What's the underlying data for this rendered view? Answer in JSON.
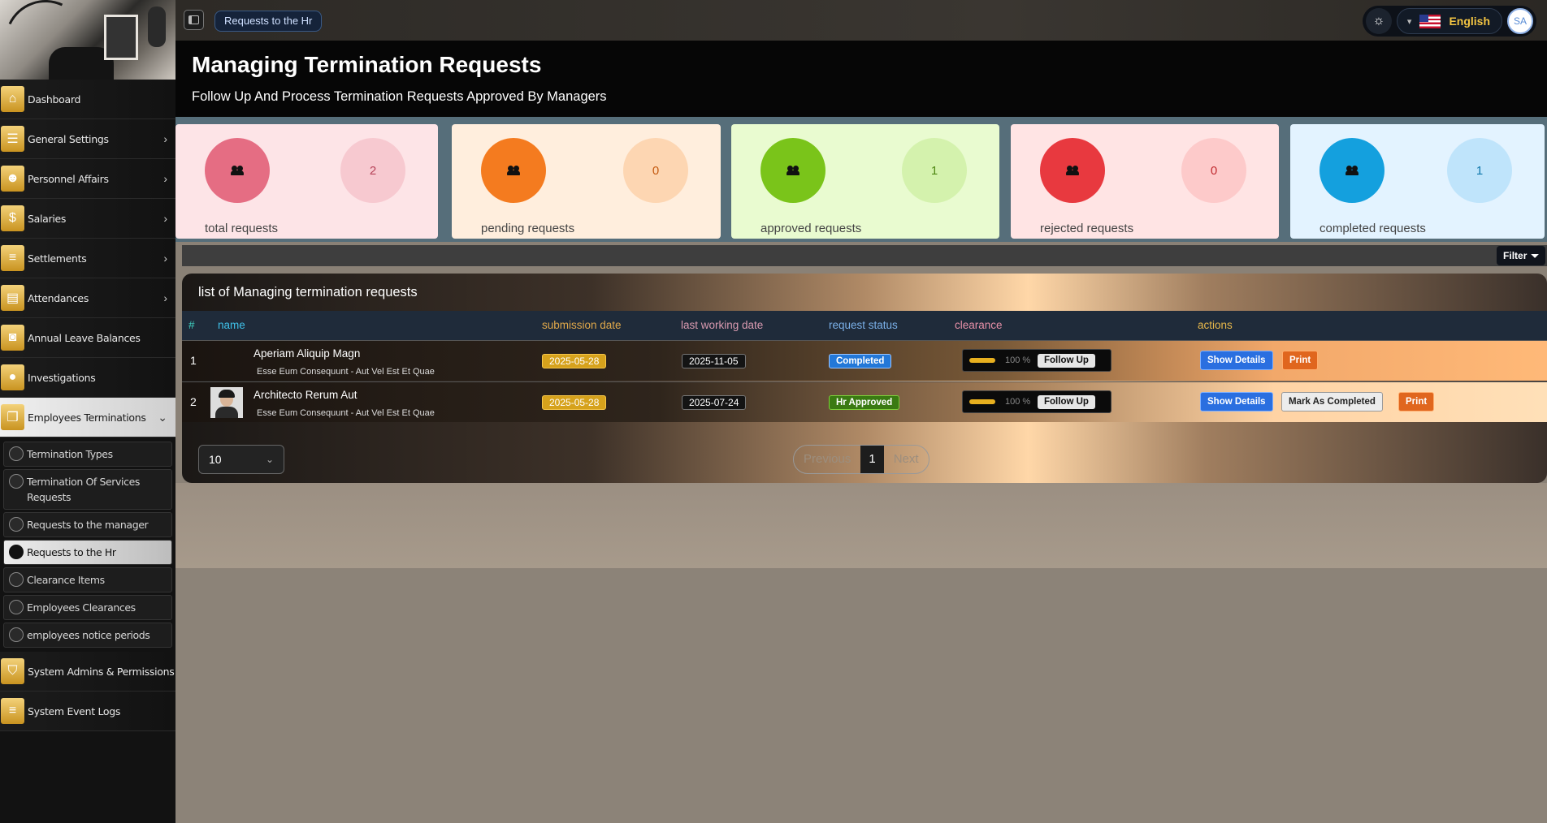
{
  "sidebar": {
    "items": [
      {
        "label": "Dashboard",
        "icon": "home-icon",
        "glyph": "⌂",
        "has_chevron": false
      },
      {
        "label": "General Settings",
        "icon": "sliders-icon",
        "glyph": "☰",
        "has_chevron": true
      },
      {
        "label": "Personnel Affairs",
        "icon": "users-icon",
        "glyph": "☻",
        "has_chevron": true
      },
      {
        "label": "Salaries",
        "icon": "money-icon",
        "glyph": "$",
        "has_chevron": true
      },
      {
        "label": "Settlements",
        "icon": "list-icon",
        "glyph": "≡",
        "has_chevron": true
      },
      {
        "label": "Attendances",
        "icon": "briefcase-icon",
        "glyph": "▤",
        "has_chevron": true
      },
      {
        "label": "Annual Leave Balances",
        "icon": "bag-icon",
        "glyph": "◙",
        "has_chevron": false
      },
      {
        "label": "Investigations",
        "icon": "circle-icon",
        "glyph": "●",
        "has_chevron": false
      },
      {
        "label": "Employees Terminations",
        "icon": "copy-icon",
        "glyph": "❐",
        "has_chevron": true
      }
    ],
    "sub_items": [
      {
        "label": "Termination Types"
      },
      {
        "label": "Termination Of Services Requests"
      },
      {
        "label": "Requests to the manager"
      },
      {
        "label": "Requests to the Hr"
      },
      {
        "label": "Clearance Items"
      },
      {
        "label": "Employees Clearances"
      },
      {
        "label": "employees notice periods"
      }
    ],
    "bottom_items": [
      {
        "label": "System Admins & Permissions",
        "icon": "shield-icon",
        "glyph": "⛉"
      },
      {
        "label": "System Event Logs",
        "icon": "list-icon",
        "glyph": "≡"
      }
    ]
  },
  "topbar": {
    "breadcrumb": "Requests to the Hr",
    "language": "English",
    "avatar_initials": "SA"
  },
  "header": {
    "title": "Managing Termination Requests",
    "subtitle": "Follow Up And Process Termination Requests Approved By Managers"
  },
  "stats": [
    {
      "label": "total requests",
      "value": "2",
      "bg": "#fde4e7",
      "circle": "#e56d83",
      "num_bg": "#f7c9d0",
      "num_color": "#b64258"
    },
    {
      "label": "pending requests",
      "value": "0",
      "bg": "#ffeedd",
      "circle": "#f47b1f",
      "num_bg": "#fdd6b2",
      "num_color": "#c45a10"
    },
    {
      "label": "approved requests",
      "value": "1",
      "bg": "#e9fbd0",
      "circle": "#7ac41a",
      "num_bg": "#d4f2ad",
      "num_color": "#4d8712"
    },
    {
      "label": "rejected requests",
      "value": "0",
      "bg": "#ffe4e4",
      "circle": "#e8393f",
      "num_bg": "#fdcaca",
      "num_color": "#c02a2f"
    },
    {
      "label": "completed requests",
      "value": "1",
      "bg": "#e3f3ff",
      "circle": "#14a0de",
      "num_bg": "#bfe4fb",
      "num_color": "#0e77ab"
    }
  ],
  "filter_label": "Filter",
  "table": {
    "title": "list of Managing termination requests",
    "columns": {
      "index": "#",
      "name": "name",
      "submission_date": "submission date",
      "last_working_date": "last working date",
      "request_status": "request status",
      "clearance": "clearance",
      "actions": "actions"
    },
    "rows": [
      {
        "index": "1",
        "name": "Aperiam Aliquip Magn",
        "subtitle": "Esse Eum Consequunt - Aut Vel Est Et Quae",
        "submission_date": "2025-05-28",
        "last_working_date": "2025-11-05",
        "status": "Completed",
        "clearance_pct": "100 %",
        "clearance_progress": 1.0,
        "follow_up": "Follow Up",
        "show_details": "Show Details",
        "print": "Print"
      },
      {
        "index": "2",
        "name": "Architecto Rerum Aut",
        "subtitle": "Esse Eum Consequunt - Aut Vel Est Et Quae",
        "submission_date": "2025-05-28",
        "last_working_date": "2025-07-24",
        "status": "Hr Approved",
        "clearance_pct": "100 %",
        "clearance_progress": 1.0,
        "follow_up": "Follow Up",
        "show_details": "Show Details",
        "mark_completed": "Mark As Completed",
        "print": "Print"
      }
    ]
  },
  "pagination": {
    "page_size": "10",
    "previous": "Previous",
    "current": "1",
    "next": "Next"
  }
}
